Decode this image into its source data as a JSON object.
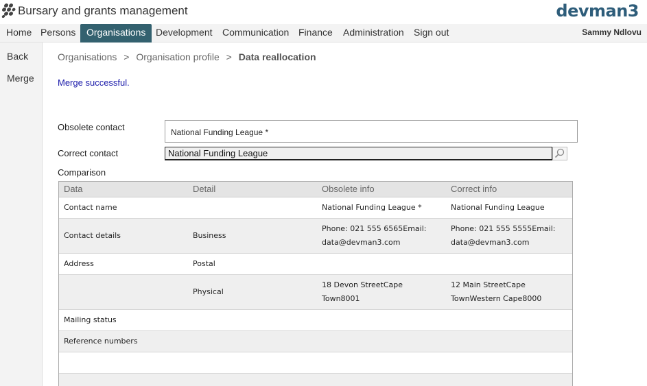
{
  "app": {
    "title": "Bursary and grants management",
    "brand": "devman3"
  },
  "nav": {
    "items": [
      {
        "label": "Home"
      },
      {
        "label": "Persons"
      },
      {
        "label": "Organisations"
      },
      {
        "label": "Development"
      },
      {
        "label": "Communication"
      },
      {
        "label": "Finance"
      },
      {
        "label": "Administration"
      },
      {
        "label": "Sign out"
      }
    ],
    "active": "Organisations",
    "user": "Sammy Ndlovu"
  },
  "sidebar": {
    "items": [
      {
        "label": "Back"
      },
      {
        "label": "Merge"
      }
    ]
  },
  "breadcrumb": {
    "items": [
      "Organisations",
      "Organisation profile"
    ],
    "separator": ">",
    "current": "Data reallocation"
  },
  "message": "Merge successful.",
  "form": {
    "obsolete_label": "Obsolete contact",
    "obsolete_value": "National Funding League *",
    "correct_label": "Correct contact",
    "correct_value": "National Funding League",
    "comparison_label": "Comparison"
  },
  "table": {
    "headers": [
      "Data",
      "Detail",
      "Obsolete info",
      "Correct info"
    ],
    "rows": [
      {
        "data": "Contact name",
        "detail": "",
        "obsolete": [
          "National Funding League *"
        ],
        "correct": [
          "National Funding League"
        ]
      },
      {
        "data": "Contact details",
        "detail": "Business",
        "obsolete": [
          "Phone: 021 555 6565Email:",
          "data@devman3.com"
        ],
        "correct": [
          "Phone: 021 555 5555Email:",
          "data@devman3.com"
        ]
      },
      {
        "data": "Address",
        "detail": "Postal",
        "obsolete": [],
        "correct": []
      },
      {
        "data": "",
        "detail": "Physical",
        "obsolete": [
          "18 Devon StreetCape",
          "Town8001"
        ],
        "correct": [
          "12 Main StreetCape",
          "TownWestern Cape8000"
        ]
      },
      {
        "data": "Mailing status",
        "detail": "",
        "obsolete": [],
        "correct": []
      },
      {
        "data": "Reference numbers",
        "detail": "",
        "obsolete": [],
        "correct": []
      },
      {
        "data": "",
        "detail": "",
        "obsolete": [],
        "correct": []
      },
      {
        "data": "",
        "detail": "",
        "obsolete": [],
        "correct": []
      }
    ]
  },
  "colors": {
    "nav_active": "#33616f",
    "brand": "#2e5d7a",
    "message": "#1a1aaa",
    "row_alt": "#efefef"
  }
}
